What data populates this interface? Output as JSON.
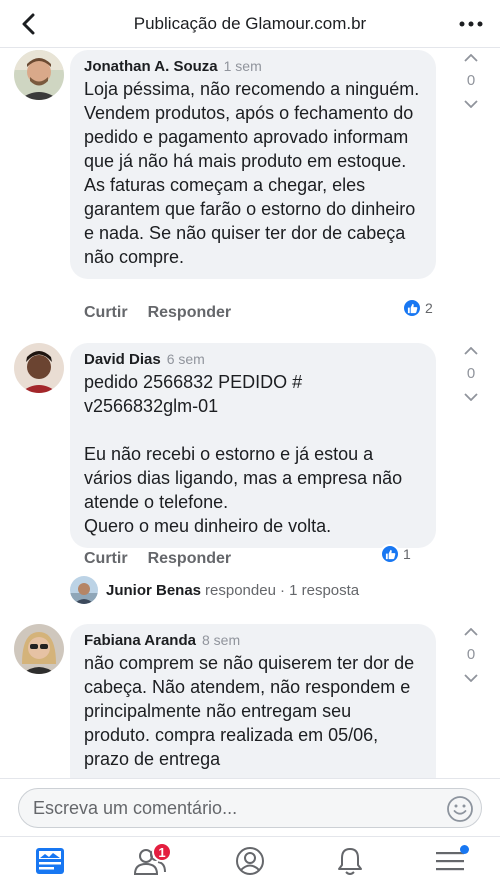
{
  "header": {
    "title": "Publicação de Glamour.com.br"
  },
  "comments": [
    {
      "author": "Jonathan A. Souza",
      "time": "1 sem",
      "text": "Loja péssima, não recomendo a ninguém. Vendem produtos, após o fechamento do pedido e pagamento aprovado informam que já não há mais produto em estoque. As faturas começam a chegar, eles garantem que farão o estorno do dinheiro e nada. Se não quiser ter dor de cabeça não compre.",
      "like_label": "Curtir",
      "reply_label": "Responder",
      "reactions": "2",
      "votes": "0"
    },
    {
      "author": "David Dias",
      "time": "6 sem",
      "text": "pedido 2566832     PEDIDO #\nv2566832glm-01\n\nEu não recebi o estorno e já estou a vários dias ligando, mas a empresa não atende o telefone.\nQuero o meu dinheiro de volta.",
      "like_label": "Curtir",
      "reply_label": "Responder",
      "reactions": "1",
      "votes": "0",
      "reply_summary": {
        "name": "Junior Benas",
        "action": "respondeu",
        "count": "· 1 resposta"
      }
    },
    {
      "author": "Fabiana Aranda",
      "time": "8 sem",
      "text": "não comprem se não quiserem ter dor de cabeça. Não atendem, não respondem e principalmente não entregam seu produto. compra realizada em 05/06, prazo de entrega",
      "votes": "0"
    }
  ],
  "composer": {
    "placeholder": "Escreva um comentário..."
  },
  "tabbar": {
    "notifications_badge": "1"
  },
  "colors": {
    "accent": "#1877f2",
    "badge": "#e41e3f",
    "bubble": "#f0f2f5"
  }
}
